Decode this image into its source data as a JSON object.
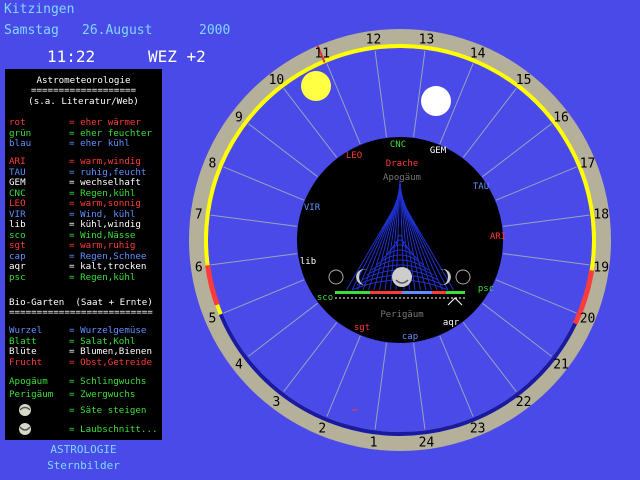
{
  "header": {
    "city": "Kitzingen",
    "weekday": "Samstag",
    "date": "26.August",
    "year": "2000",
    "time": "11:22",
    "timezone": "WEZ +2"
  },
  "legend": {
    "title": "Astrometeorologie",
    "rule": "===================",
    "subtitle": "(s.a. Literatur/Web)",
    "colors": [
      {
        "key": "rot",
        "value": "= eher wärmer",
        "color": "#ff3a3a"
      },
      {
        "key": "grün",
        "value": "= eher feuchter",
        "color": "#3adf3a"
      },
      {
        "key": "blau",
        "value": "= eher kühl",
        "color": "#5f8fff"
      }
    ],
    "signs": [
      {
        "key": "ARI",
        "value": "= warm,windig",
        "color": "#ff3a3a"
      },
      {
        "key": "TAU",
        "value": "= ruhig,feucht",
        "color": "#5f8fff"
      },
      {
        "key": "GEM",
        "value": "= wechselhaft",
        "color": "#ffffff"
      },
      {
        "key": "CNC",
        "value": "= Regen,kühl",
        "color": "#3adf3a"
      },
      {
        "key": "LEO",
        "value": "= warm,sonnig",
        "color": "#ff3a3a"
      },
      {
        "key": "VIR",
        "value": "= Wind, kühl",
        "color": "#5f8fff"
      },
      {
        "key": "lib",
        "value": "= kühl,windig",
        "color": "#ffffff"
      },
      {
        "key": "sco",
        "value": "= Wind,Nässe",
        "color": "#3adf3a"
      },
      {
        "key": "sgt",
        "value": "= warm,ruhig",
        "color": "#ff3a3a"
      },
      {
        "key": "cap",
        "value": "= Regen,Schnee",
        "color": "#5f8fff"
      },
      {
        "key": "aqr",
        "value": "= kalt,trocken",
        "color": "#ffffff"
      },
      {
        "key": "psc",
        "value": "= Regen,kühl",
        "color": "#3adf3a"
      }
    ],
    "garden_title": "Bio-Garten  (Saat + Ernte)",
    "garden_rule": "==========================",
    "garden": [
      {
        "key": "Wurzel",
        "value": "= Wurzelgemüse",
        "color": "#5f8fff"
      },
      {
        "key": "Blatt",
        "value": "= Salat,Kohl",
        "color": "#3adf3a"
      },
      {
        "key": "Blüte",
        "value": "= Blumen,Bienen",
        "color": "#ffffff"
      },
      {
        "key": "Frucht",
        "value": "= Obst,Getreide",
        "color": "#ff3a3a"
      }
    ],
    "apsides": [
      {
        "key": "Apogäum",
        "value": "= Schlingwuchs",
        "color": "#3adf3a"
      },
      {
        "key": "Perigäum",
        "value": "= Zwergwuchs",
        "color": "#3adf3a"
      }
    ],
    "moon_rules": [
      {
        "value": "= Säte steigen",
        "color": "#3adf3a"
      },
      {
        "value": "= Laubschnitt...",
        "color": "#3adf3a"
      }
    ]
  },
  "footer": {
    "line1": "ASTROLOGIE",
    "line2": "Sternbilder"
  },
  "dial": {
    "hours": [
      "1",
      "2",
      "3",
      "4",
      "5",
      "6",
      "7",
      "8",
      "9",
      "10",
      "11",
      "12",
      "13",
      "14",
      "15",
      "16",
      "17",
      "18",
      "19",
      "20",
      "21",
      "22",
      "23",
      "24"
    ],
    "signs": [
      {
        "label": "CNC",
        "color": "#3adf3a"
      },
      {
        "label": "GEM",
        "color": "#ffffff"
      },
      {
        "label": "TAU",
        "color": "#5f8fff"
      },
      {
        "label": "ARI",
        "color": "#ff3a3a"
      },
      {
        "label": "psc",
        "color": "#3adf3a"
      },
      {
        "label": "aqr",
        "color": "#ffffff"
      },
      {
        "label": "cap",
        "color": "#5f8fff"
      },
      {
        "label": "sgt",
        "color": "#ff3a3a"
      },
      {
        "label": "sco",
        "color": "#3adf3a"
      },
      {
        "label": "lib",
        "color": "#ffffff"
      },
      {
        "label": "VIR",
        "color": "#5f8fff"
      },
      {
        "label": "LEO",
        "color": "#ff3a3a"
      }
    ],
    "drache": "Drache",
    "apogee": "Apogäum",
    "perigee": "Perigäum",
    "colors": {
      "background": "#4a4ae8",
      "ring": "#b4b09a",
      "day_arc": "#ffff00",
      "night_arc": "#1a1aa0",
      "dawn_dusk": "#ff3a3a",
      "sun": "#ffff44",
      "moon": "#ffffff"
    }
  }
}
